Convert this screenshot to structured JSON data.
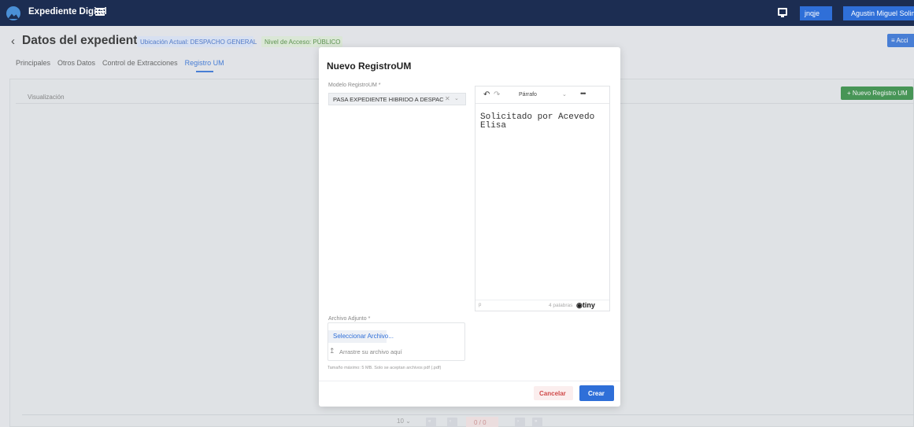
{
  "topbar": {
    "app_title": "Expediente Digital",
    "user_short": "jnqje",
    "user_full": "Agustin Miguel Solimo"
  },
  "header": {
    "back_icon": "‹",
    "title": "Datos del expediente",
    "location_badge": "Ubicación Actual: DESPACHO GENERAL",
    "access_badge": "Nivel de Acceso: PÚBLICO",
    "actions_label": "≡ Acci"
  },
  "tabs": [
    {
      "label": "Principales",
      "active": false
    },
    {
      "label": "Otros Datos",
      "active": false
    },
    {
      "label": "Control de Extracciones",
      "active": false
    },
    {
      "label": "Registro UM",
      "active": true
    }
  ],
  "main": {
    "view_label": "Visualización",
    "new_button": "+ Nuevo Registro UM"
  },
  "pager": {
    "page_size": "10",
    "count": "0 / 0"
  },
  "modal": {
    "title": "Nuevo RegistroUM",
    "model_label": "Modelo RegistroUM *",
    "model_value": "PASA EXPEDIENTE HIBRIDO A DESPAC",
    "editor": {
      "block_format": "Párrafo",
      "content": "Solicitado por Acevedo Elisa",
      "path": "p",
      "word_count": "4 palabras",
      "brand": "tiny"
    },
    "attachment_label": "Archivo Adjunto *",
    "select_file_button": "Seleccionar Archivo...",
    "drag_text": "Arrastre su archivo aquí",
    "hint": "Tamaño máximo: 5 MB. Solo se aceptan archivos pdf (.pdf)",
    "cancel_button": "Cancelar",
    "create_button": "Crear"
  },
  "colors": {
    "topbar": "#1c2d52",
    "primary": "#2f6fd8",
    "success": "#2e8b3e",
    "danger": "#d04a4a"
  }
}
